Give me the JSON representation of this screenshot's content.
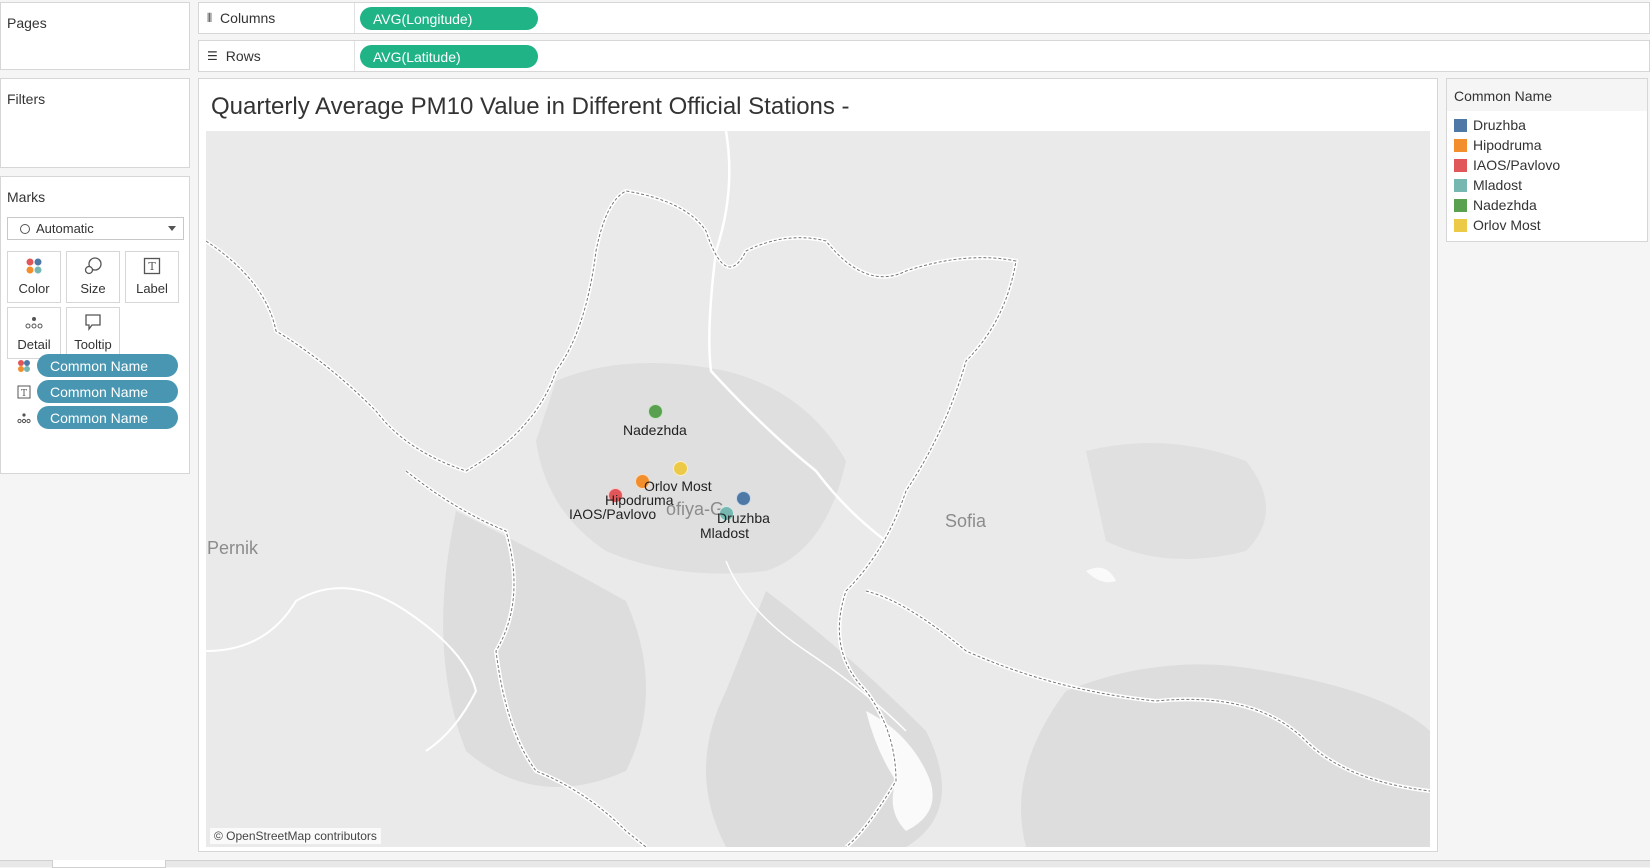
{
  "pages": {
    "title": "Pages"
  },
  "filters": {
    "title": "Filters"
  },
  "marks": {
    "title": "Marks",
    "mark_type": "Automatic",
    "buttons": {
      "color": "Color",
      "size": "Size",
      "label": "Label",
      "detail": "Detail",
      "tooltip": "Tooltip"
    },
    "pills": [
      "Common Name",
      "Common Name",
      "Common Name"
    ]
  },
  "shelves": {
    "columns": {
      "label": "Columns",
      "pill": "AVG(Longitude)"
    },
    "rows": {
      "label": "Rows",
      "pill": "AVG(Latitude)"
    }
  },
  "sheet": {
    "title": "Quarterly Average PM10 Value in Different Official Stations -",
    "attribution": "© OpenStreetMap contributors",
    "place_labels": {
      "sofia": "Sofia",
      "pernik": "Pernik",
      "sofiya_partial": "ofiya-G"
    }
  },
  "legend": {
    "title": "Common Name",
    "items": [
      {
        "name": "Druzhba",
        "color": "#4e79a7"
      },
      {
        "name": "Hipodruma",
        "color": "#f28e2b"
      },
      {
        "name": "IAOS/Pavlovo",
        "color": "#e15759"
      },
      {
        "name": "Mladost",
        "color": "#76b7b2"
      },
      {
        "name": "Nadezhda",
        "color": "#59a14f"
      },
      {
        "name": "Orlov Most",
        "color": "#edc948"
      }
    ]
  },
  "chart_data": {
    "type": "scatter",
    "title": "Quarterly Average PM10 Value in Different Official Stations -",
    "x_field": "AVG(Longitude)",
    "y_field": "AVG(Latitude)",
    "series": [
      {
        "name": "Druzhba",
        "color": "#4e79a7"
      },
      {
        "name": "Hipodruma",
        "color": "#f28e2b"
      },
      {
        "name": "IAOS/Pavlovo",
        "color": "#e15759"
      },
      {
        "name": "Mladost",
        "color": "#76b7b2"
      },
      {
        "name": "Nadezhda",
        "color": "#59a14f"
      },
      {
        "name": "Orlov Most",
        "color": "#edc948"
      }
    ],
    "legend": "right"
  }
}
